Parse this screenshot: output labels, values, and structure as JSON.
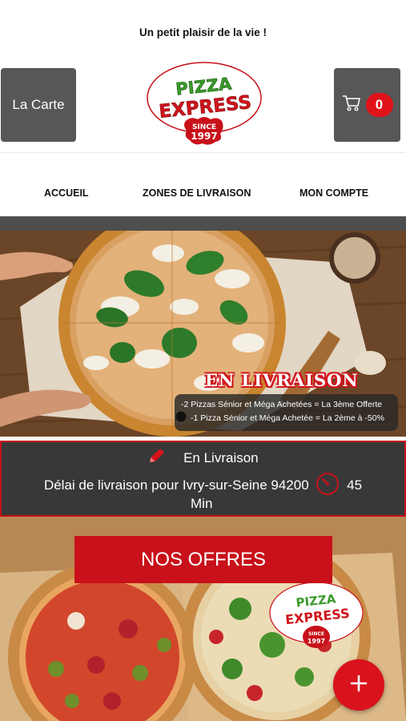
{
  "header": {
    "tagline": "Un petit plaisir de la vie !",
    "menu_button": "La Carte",
    "cart_count": "0",
    "logo": {
      "line1": "PIZZA",
      "line2": "EXPRESS",
      "since": "SINCE",
      "year": "1997"
    }
  },
  "nav": {
    "items": [
      {
        "label": "ACCUEIL"
      },
      {
        "label": "ZONES DE LIVRAISON"
      },
      {
        "label": "MON COMPTE"
      }
    ]
  },
  "hero": {
    "title": "EN LIVRAISON",
    "offer1": "-2 Pizzas Sénior et Méga Achetées = La 3ème Offerte",
    "offer2": "-1 Pizza Sénior et Méga Achetée = La 2ème à -50%"
  },
  "delivery": {
    "mode": "En Livraison",
    "info": "Délai de livraison pour Ivry-sur-Seine 94200",
    "time": "45",
    "unit": "Min"
  },
  "promo": {
    "offers_button": "NOS OFFRES",
    "logo": {
      "line1": "PIZZA",
      "line2": "EXPRESS",
      "since": "SINCE",
      "year": "1997"
    }
  },
  "icons": {
    "cart": "cart-icon",
    "pencil": "pencil-icon",
    "timer": "timer-icon",
    "plus": "plus-icon"
  },
  "colors": {
    "accent": "#c8111a",
    "dark_button": "#575757",
    "bar": "#383838"
  }
}
